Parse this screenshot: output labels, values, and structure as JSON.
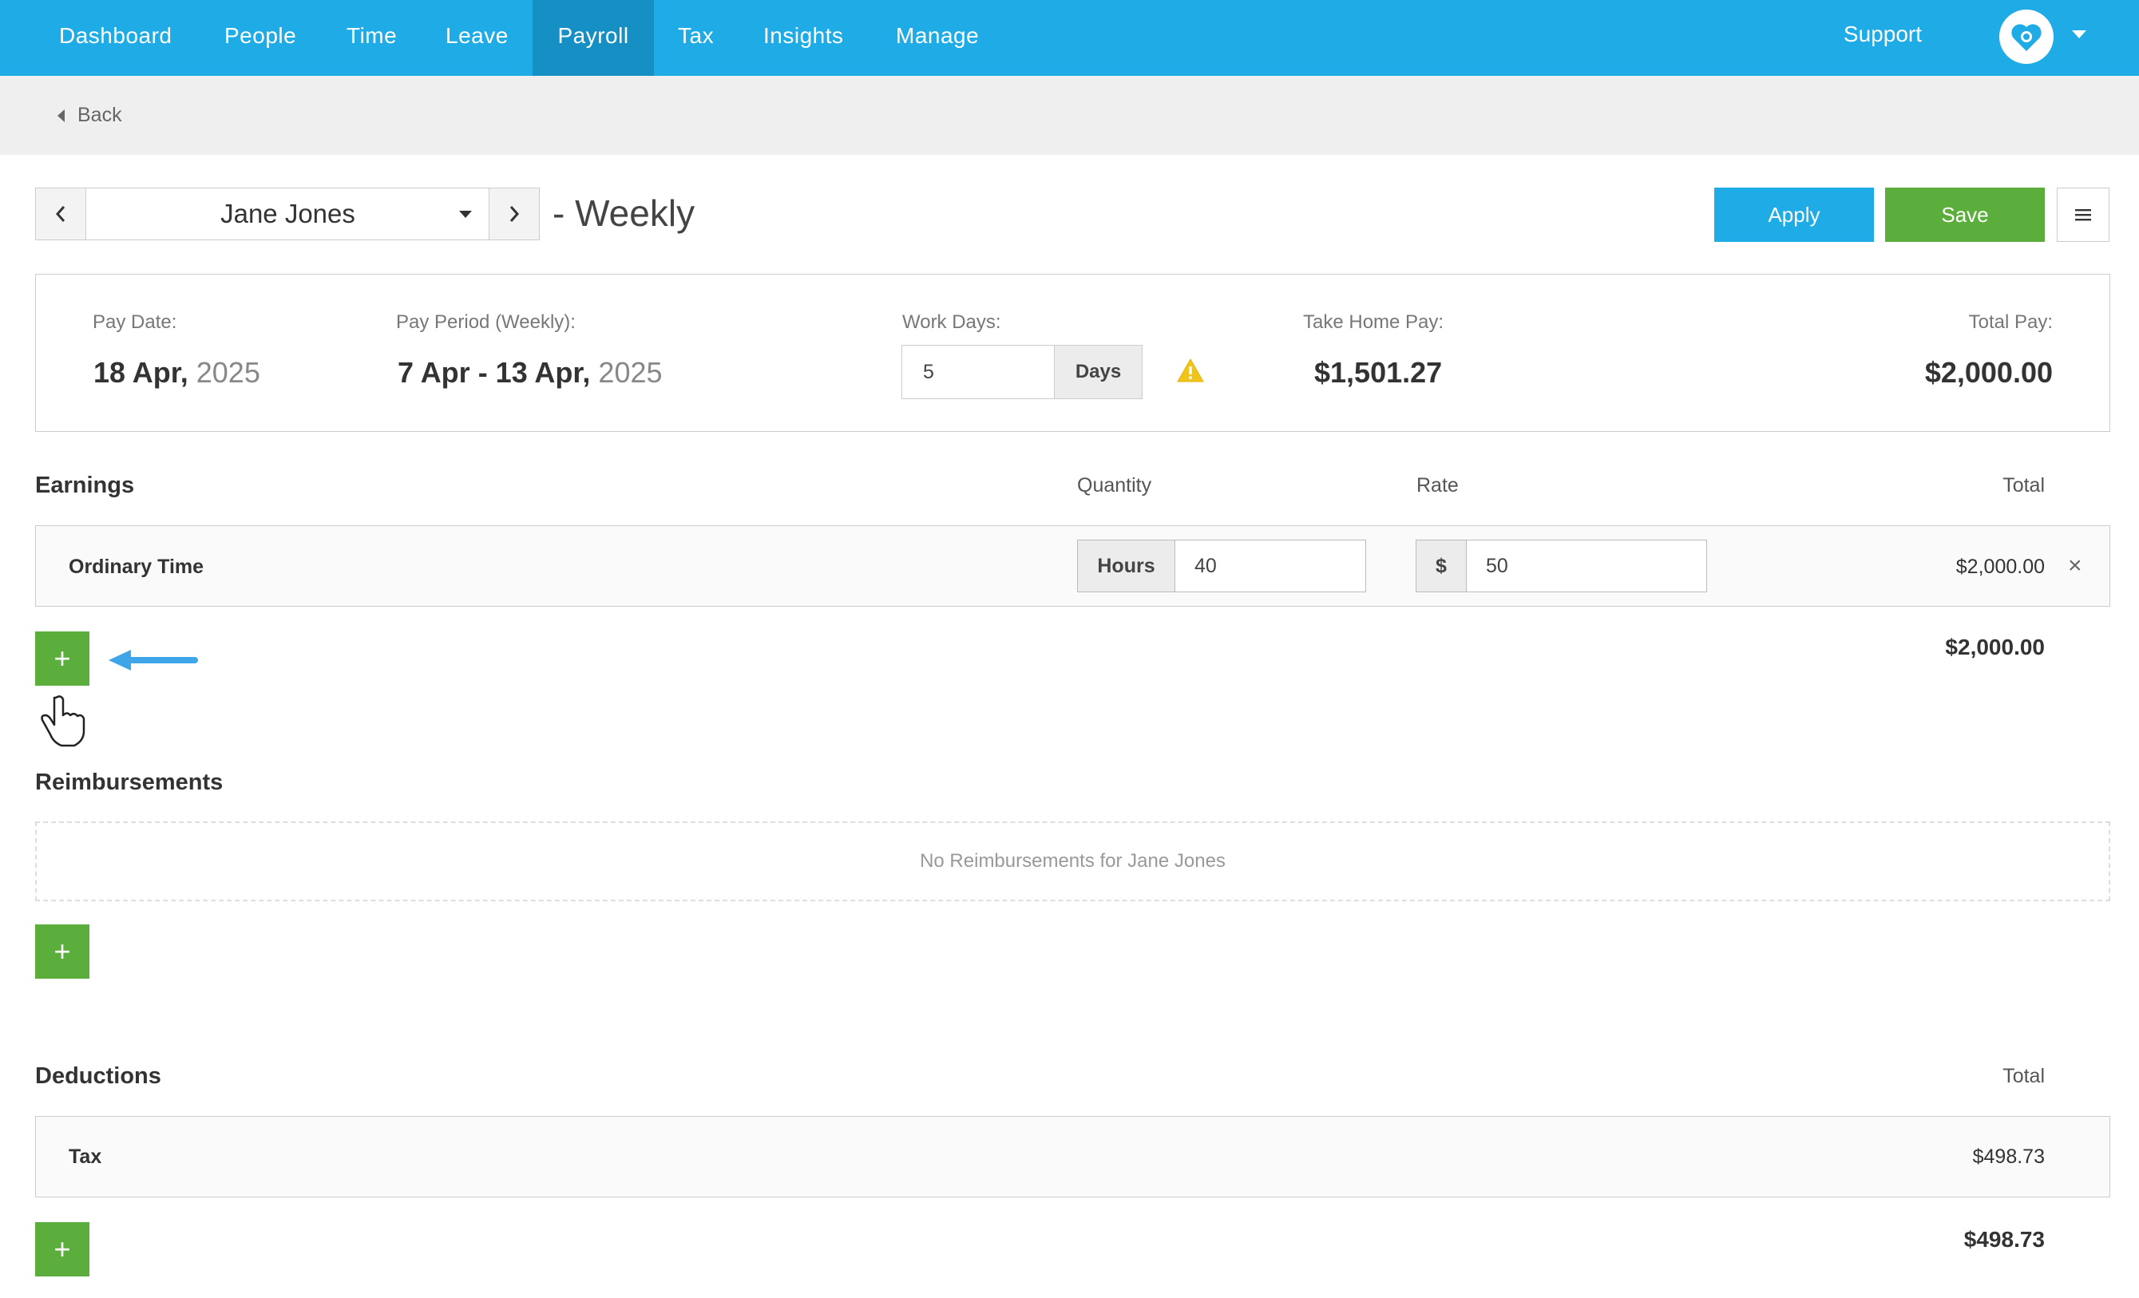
{
  "nav": {
    "items": [
      {
        "label": "Dashboard"
      },
      {
        "label": "People"
      },
      {
        "label": "Time"
      },
      {
        "label": "Leave"
      },
      {
        "label": "Payroll"
      },
      {
        "label": "Tax"
      },
      {
        "label": "Insights"
      },
      {
        "label": "Manage"
      }
    ],
    "active": "Payroll",
    "support": "Support"
  },
  "subheader": {
    "back": "Back"
  },
  "payslip": {
    "employee": "Jane Jones",
    "frequency": "- Weekly",
    "apply": "Apply",
    "save": "Save"
  },
  "summary": {
    "pay_date_label": "Pay Date:",
    "pay_date": "18 Apr,",
    "pay_date_year": "2025",
    "period_label": "Pay Period (Weekly):",
    "period": "7 Apr - 13 Apr,",
    "period_year": "2025",
    "work_days_label": "Work Days:",
    "work_days_value": "5",
    "work_days_unit": "Days",
    "take_home_label": "Take Home Pay:",
    "take_home": "$1,501.27",
    "total_label": "Total Pay:",
    "total": "$2,000.00"
  },
  "earnings": {
    "title": "Earnings",
    "col_quantity": "Quantity",
    "col_rate": "Rate",
    "col_total": "Total",
    "rows": [
      {
        "name": "Ordinary Time",
        "unit": "Hours",
        "quantity": "40",
        "rate_unit": "$",
        "rate": "50",
        "total": "$2,000.00"
      }
    ],
    "subtotal": "$2,000.00",
    "add_label": "+"
  },
  "reimbursements": {
    "title": "Reimbursements",
    "empty": "No Reimbursements for Jane Jones",
    "add_label": "+"
  },
  "deductions": {
    "title": "Deductions",
    "col_total": "Total",
    "rows": [
      {
        "name": "Tax",
        "total": "$498.73"
      }
    ],
    "subtotal": "$498.73",
    "add_label": "+"
  },
  "colors": {
    "nav": "#1eabe6",
    "nav_active": "#1690c4",
    "apply": "#1eabe6",
    "save": "#5bad3c",
    "warning": "#f0c419",
    "arrow": "#3ea6e8"
  }
}
